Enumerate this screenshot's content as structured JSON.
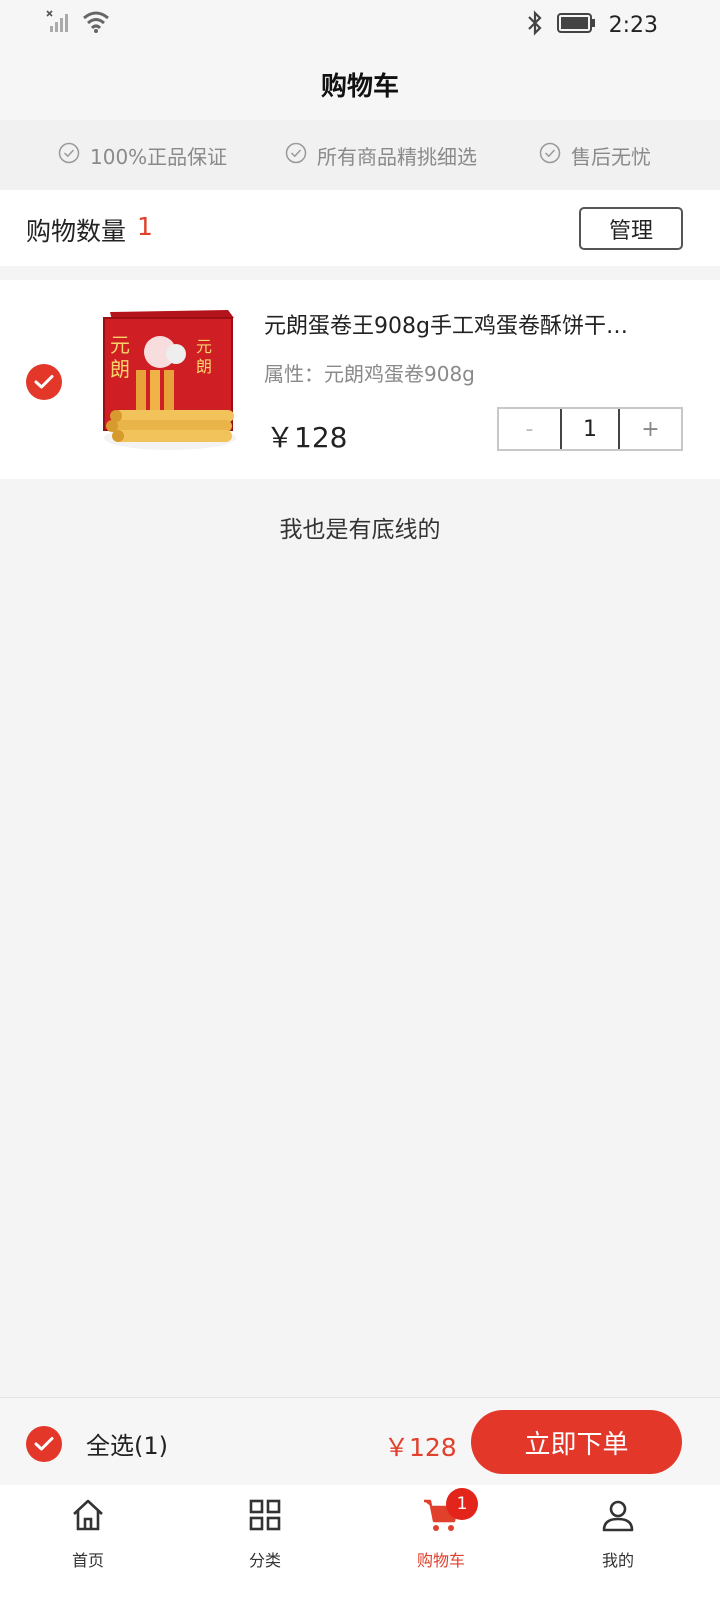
{
  "status_bar": {
    "time": "2:23"
  },
  "header": {
    "title": "购物车"
  },
  "guarantees": [
    {
      "label": "100%正品保证",
      "icon": "check-circle-icon"
    },
    {
      "label": "所有商品精挑细选",
      "icon": "check-circle-icon"
    },
    {
      "label": "售后无忧",
      "icon": "check-circle-icon"
    }
  ],
  "cart_summary": {
    "count_label": "购物数量",
    "count": "1",
    "manage_label": "管理"
  },
  "items": [
    {
      "title": "元朗蛋卷王908g手工鸡蛋卷酥饼干…",
      "attribute": "属性：元朗鸡蛋卷908g",
      "price": "￥128",
      "decrement_label": "-",
      "quantity": "1",
      "increment_label": "+",
      "selected": true
    }
  ],
  "bottom_notice": "我也是有底线的",
  "checkout": {
    "select_all_label": "全选(1)",
    "total": "￥128",
    "order_label": "立即下单"
  },
  "tabbar": {
    "tabs": [
      {
        "label": "首页",
        "icon": "home-icon"
      },
      {
        "label": "分类",
        "icon": "grid-icon"
      },
      {
        "label": "购物车",
        "icon": "cart-icon",
        "active": true
      },
      {
        "label": "我的",
        "icon": "user-icon"
      }
    ],
    "cart_badge": "1"
  },
  "colors": {
    "accent": "#e3372a",
    "price": "#e0402c",
    "background": "#f4f4f4"
  }
}
